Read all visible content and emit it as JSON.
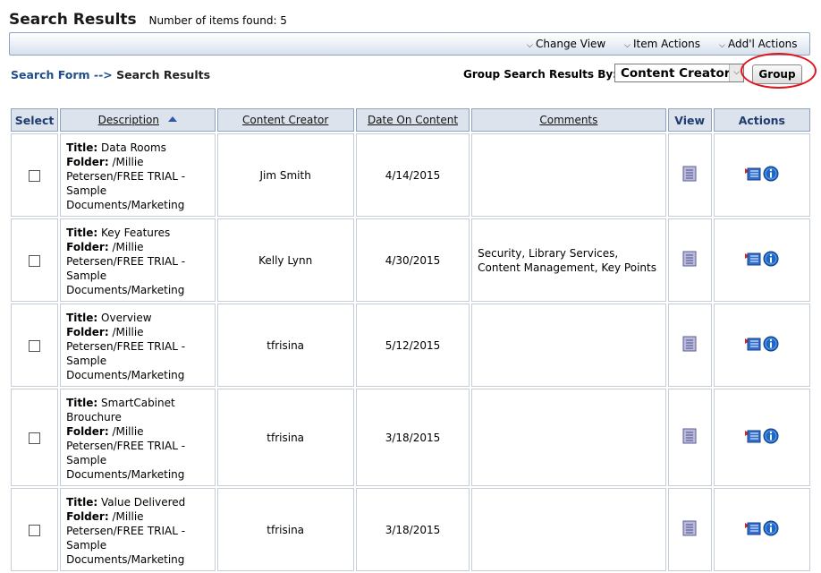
{
  "header": {
    "title": "Search Results",
    "items_found": "Number of items found: 5"
  },
  "toolbar": {
    "menus": [
      "Change View",
      "Item Actions",
      "Add'l Actions"
    ]
  },
  "breadcrumb": {
    "link": "Search Form",
    "separator": "-->",
    "current": "Search Results"
  },
  "group": {
    "label": "Group Search Results By:",
    "selected": "Content Creator",
    "button": "Group"
  },
  "table": {
    "columns": [
      "Select",
      "Description",
      "Content Creator",
      "Date On Content",
      "Comments",
      "View",
      "Actions"
    ],
    "sort_column": "Description",
    "title_label": "Title:",
    "folder_label": "Folder:",
    "rows": [
      {
        "title": "Data Rooms",
        "folder": "/Millie Petersen/FREE TRIAL - Sample Documents/Marketing",
        "creator": "Jim Smith",
        "date": "4/14/2015",
        "comments": ""
      },
      {
        "title": "Key Features",
        "folder": "/Millie Petersen/FREE TRIAL - Sample Documents/Marketing",
        "creator": "Kelly Lynn",
        "date": "4/30/2015",
        "comments": "Security, Library Services, Content Management, Key Points"
      },
      {
        "title": "Overview",
        "folder": "/Millie Petersen/FREE TRIAL - Sample Documents/Marketing",
        "creator": "tfrisina",
        "date": "5/12/2015",
        "comments": ""
      },
      {
        "title": "SmartCabinet Brouchure",
        "folder": "/Millie Petersen/FREE TRIAL - Sample Documents/Marketing",
        "creator": "tfrisina",
        "date": "3/18/2015",
        "comments": ""
      },
      {
        "title": "Value Delivered",
        "folder": "/Millie Petersen/FREE TRIAL - Sample Documents/Marketing",
        "creator": "tfrisina",
        "date": "3/18/2015",
        "comments": ""
      }
    ]
  },
  "icons": {
    "view": "document-icon",
    "actions": [
      "properties-icon",
      "info-icon"
    ]
  },
  "colors": {
    "link": "#1f4e8c",
    "header_bg": "#dde3ec",
    "highlight": "#e0141e",
    "info_blue": "#1d67c9"
  }
}
